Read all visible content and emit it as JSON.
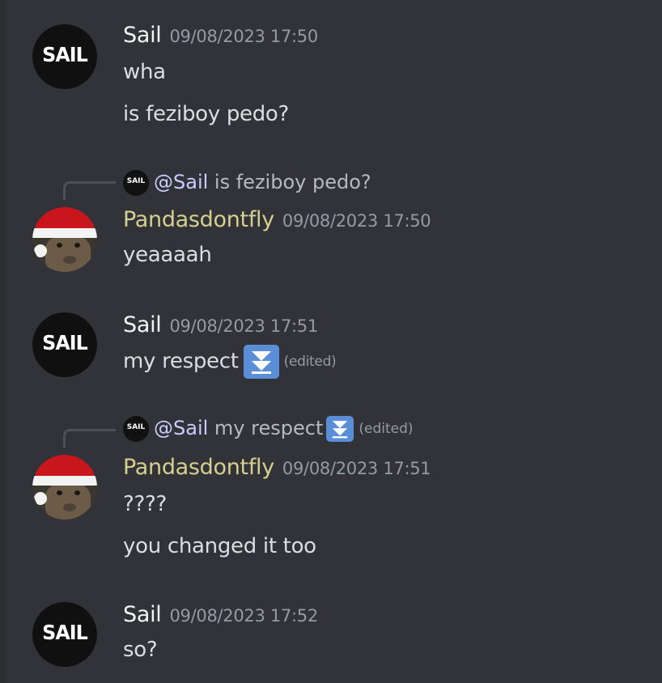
{
  "messages": [
    {
      "author": "Sail",
      "timestamp": "09/08/2023 17:50",
      "lines": [
        "wha",
        "is feziboy pedo?"
      ]
    },
    {
      "author": "Pandasdontfly",
      "timestamp": "09/08/2023 17:50",
      "reply": {
        "mention": "@Sail",
        "text": "is feziboy pedo?"
      },
      "lines": [
        "yeaaaah"
      ]
    },
    {
      "author": "Sail",
      "timestamp": "09/08/2023 17:51",
      "lines": [
        "my respect"
      ],
      "edited_label": "(edited)"
    },
    {
      "author": "Pandasdontfly",
      "timestamp": "09/08/2023 17:51",
      "reply": {
        "mention": "@Sail",
        "text": "my respect",
        "edited_label": "(edited)"
      },
      "lines": [
        "????",
        "you changed it too"
      ]
    },
    {
      "author": "Sail",
      "timestamp": "09/08/2023 17:52",
      "lines": [
        "so?"
      ]
    }
  ],
  "avatars": {
    "sail_logo_text": "SAIL",
    "sail_mini_text": "SAIL"
  },
  "colors": {
    "background": "#313338",
    "username_default": "#f2f3f5",
    "username_pandas": "#d6d090",
    "timestamp": "#949ba4",
    "emoji_bg": "#5a8ed6"
  },
  "icons": {
    "emoji": "double-down-arrow-icon"
  }
}
